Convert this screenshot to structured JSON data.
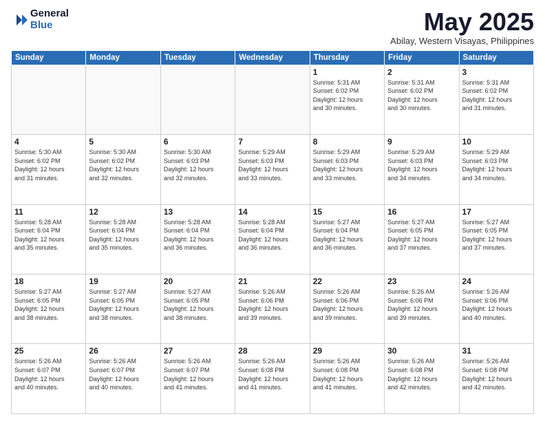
{
  "logo": {
    "general": "General",
    "blue": "Blue"
  },
  "title": "May 2025",
  "location": "Abilay, Western Visayas, Philippines",
  "days_of_week": [
    "Sunday",
    "Monday",
    "Tuesday",
    "Wednesday",
    "Thursday",
    "Friday",
    "Saturday"
  ],
  "weeks": [
    [
      {
        "day": "",
        "info": ""
      },
      {
        "day": "",
        "info": ""
      },
      {
        "day": "",
        "info": ""
      },
      {
        "day": "",
        "info": ""
      },
      {
        "day": "1",
        "info": "Sunrise: 5:31 AM\nSunset: 6:02 PM\nDaylight: 12 hours\nand 30 minutes."
      },
      {
        "day": "2",
        "info": "Sunrise: 5:31 AM\nSunset: 6:02 PM\nDaylight: 12 hours\nand 30 minutes."
      },
      {
        "day": "3",
        "info": "Sunrise: 5:31 AM\nSunset: 6:02 PM\nDaylight: 12 hours\nand 31 minutes."
      }
    ],
    [
      {
        "day": "4",
        "info": "Sunrise: 5:30 AM\nSunset: 6:02 PM\nDaylight: 12 hours\nand 31 minutes."
      },
      {
        "day": "5",
        "info": "Sunrise: 5:30 AM\nSunset: 6:02 PM\nDaylight: 12 hours\nand 32 minutes."
      },
      {
        "day": "6",
        "info": "Sunrise: 5:30 AM\nSunset: 6:03 PM\nDaylight: 12 hours\nand 32 minutes."
      },
      {
        "day": "7",
        "info": "Sunrise: 5:29 AM\nSunset: 6:03 PM\nDaylight: 12 hours\nand 33 minutes."
      },
      {
        "day": "8",
        "info": "Sunrise: 5:29 AM\nSunset: 6:03 PM\nDaylight: 12 hours\nand 33 minutes."
      },
      {
        "day": "9",
        "info": "Sunrise: 5:29 AM\nSunset: 6:03 PM\nDaylight: 12 hours\nand 34 minutes."
      },
      {
        "day": "10",
        "info": "Sunrise: 5:29 AM\nSunset: 6:03 PM\nDaylight: 12 hours\nand 34 minutes."
      }
    ],
    [
      {
        "day": "11",
        "info": "Sunrise: 5:28 AM\nSunset: 6:04 PM\nDaylight: 12 hours\nand 35 minutes."
      },
      {
        "day": "12",
        "info": "Sunrise: 5:28 AM\nSunset: 6:04 PM\nDaylight: 12 hours\nand 35 minutes."
      },
      {
        "day": "13",
        "info": "Sunrise: 5:28 AM\nSunset: 6:04 PM\nDaylight: 12 hours\nand 36 minutes."
      },
      {
        "day": "14",
        "info": "Sunrise: 5:28 AM\nSunset: 6:04 PM\nDaylight: 12 hours\nand 36 minutes."
      },
      {
        "day": "15",
        "info": "Sunrise: 5:27 AM\nSunset: 6:04 PM\nDaylight: 12 hours\nand 36 minutes."
      },
      {
        "day": "16",
        "info": "Sunrise: 5:27 AM\nSunset: 6:05 PM\nDaylight: 12 hours\nand 37 minutes."
      },
      {
        "day": "17",
        "info": "Sunrise: 5:27 AM\nSunset: 6:05 PM\nDaylight: 12 hours\nand 37 minutes."
      }
    ],
    [
      {
        "day": "18",
        "info": "Sunrise: 5:27 AM\nSunset: 6:05 PM\nDaylight: 12 hours\nand 38 minutes."
      },
      {
        "day": "19",
        "info": "Sunrise: 5:27 AM\nSunset: 6:05 PM\nDaylight: 12 hours\nand 38 minutes."
      },
      {
        "day": "20",
        "info": "Sunrise: 5:27 AM\nSunset: 6:05 PM\nDaylight: 12 hours\nand 38 minutes."
      },
      {
        "day": "21",
        "info": "Sunrise: 5:26 AM\nSunset: 6:06 PM\nDaylight: 12 hours\nand 39 minutes."
      },
      {
        "day": "22",
        "info": "Sunrise: 5:26 AM\nSunset: 6:06 PM\nDaylight: 12 hours\nand 39 minutes."
      },
      {
        "day": "23",
        "info": "Sunrise: 5:26 AM\nSunset: 6:06 PM\nDaylight: 12 hours\nand 39 minutes."
      },
      {
        "day": "24",
        "info": "Sunrise: 5:26 AM\nSunset: 6:06 PM\nDaylight: 12 hours\nand 40 minutes."
      }
    ],
    [
      {
        "day": "25",
        "info": "Sunrise: 5:26 AM\nSunset: 6:07 PM\nDaylight: 12 hours\nand 40 minutes."
      },
      {
        "day": "26",
        "info": "Sunrise: 5:26 AM\nSunset: 6:07 PM\nDaylight: 12 hours\nand 40 minutes."
      },
      {
        "day": "27",
        "info": "Sunrise: 5:26 AM\nSunset: 6:07 PM\nDaylight: 12 hours\nand 41 minutes."
      },
      {
        "day": "28",
        "info": "Sunrise: 5:26 AM\nSunset: 6:08 PM\nDaylight: 12 hours\nand 41 minutes."
      },
      {
        "day": "29",
        "info": "Sunrise: 5:26 AM\nSunset: 6:08 PM\nDaylight: 12 hours\nand 41 minutes."
      },
      {
        "day": "30",
        "info": "Sunrise: 5:26 AM\nSunset: 6:08 PM\nDaylight: 12 hours\nand 42 minutes."
      },
      {
        "day": "31",
        "info": "Sunrise: 5:26 AM\nSunset: 6:08 PM\nDaylight: 12 hours\nand 42 minutes."
      }
    ]
  ]
}
